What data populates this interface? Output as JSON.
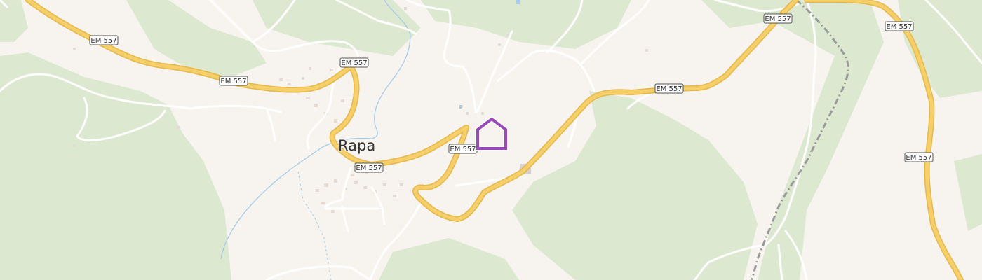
{
  "map": {
    "place_label": "Rapa",
    "road_ref": "EM 557",
    "marker_icon": "home-marker-icon",
    "colors": {
      "background": "#f7f4f0",
      "forest": "#dde8d0",
      "major_road": "#f4cf6a",
      "major_road_casing": "#e7b84c",
      "minor_road": "#ffffff",
      "water": "#a6cbe8",
      "railway": "#9a9a9a",
      "marker": "#9b48b8"
    }
  }
}
